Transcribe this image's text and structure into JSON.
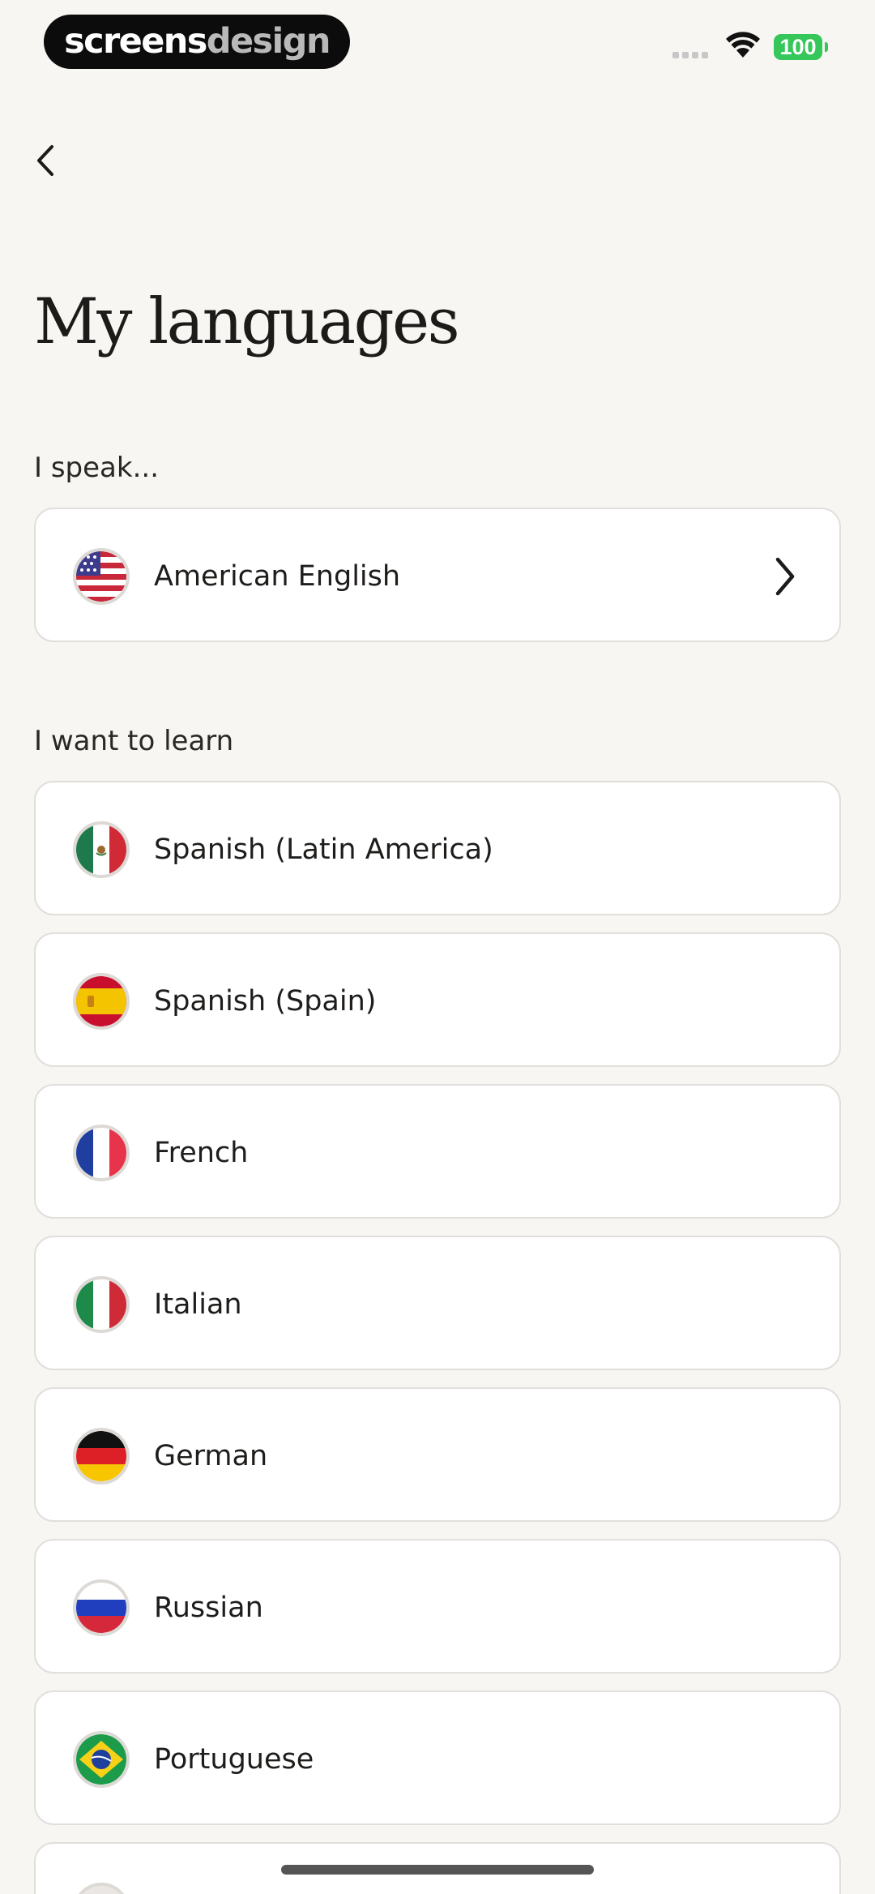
{
  "status_bar": {
    "brand_part1": "screens",
    "brand_part2": "design",
    "battery": "100"
  },
  "header": {
    "back_icon": "chevron-left-icon",
    "title": "My languages"
  },
  "speak": {
    "label": "I speak...",
    "language": {
      "name": "American English",
      "flag": "us-flag-icon"
    }
  },
  "learn": {
    "label": "I want to learn",
    "languages": [
      {
        "name": "Spanish (Latin America)",
        "flag": "mexico-flag-icon"
      },
      {
        "name": "Spanish (Spain)",
        "flag": "spain-flag-icon"
      },
      {
        "name": "French",
        "flag": "france-flag-icon"
      },
      {
        "name": "Italian",
        "flag": "italy-flag-icon"
      },
      {
        "name": "German",
        "flag": "germany-flag-icon"
      },
      {
        "name": "Russian",
        "flag": "russia-flag-icon"
      },
      {
        "name": "Portuguese",
        "flag": "brazil-flag-icon"
      }
    ]
  },
  "colors": {
    "background": "#f8f6f3",
    "card": "#ffffff",
    "card_border": "#e1dedb",
    "battery_green": "#35c759"
  }
}
